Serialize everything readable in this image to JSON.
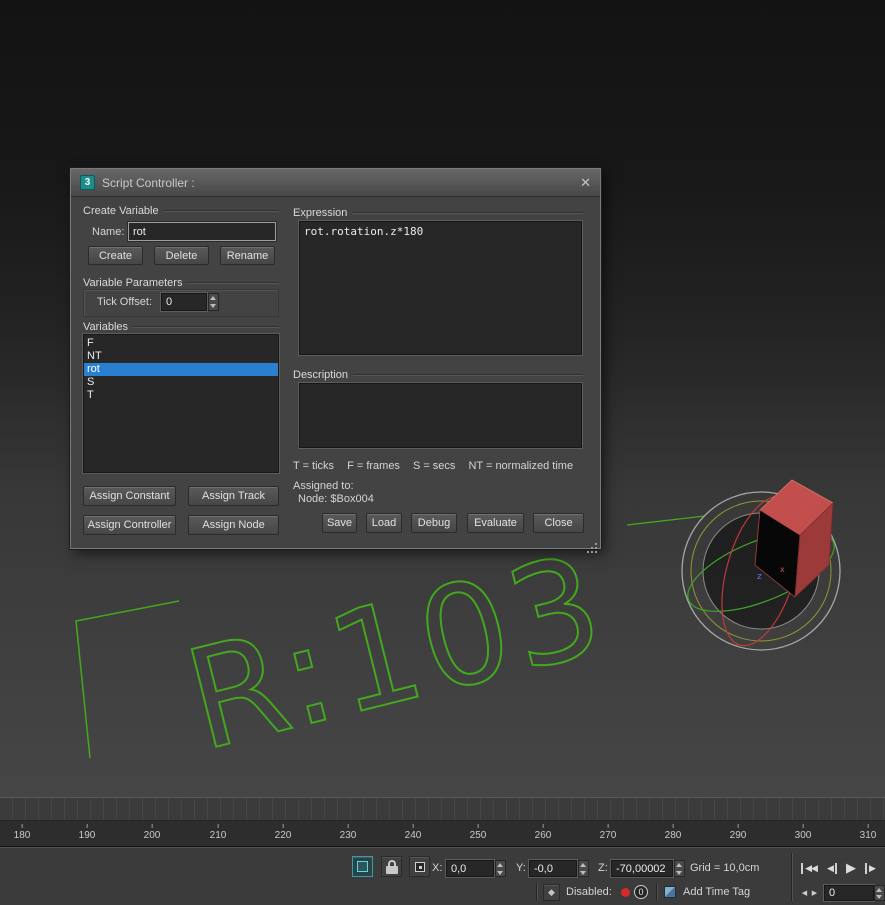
{
  "icons": {
    "logo": "3",
    "close": "✕",
    "key_mode": "◆",
    "transport_start": "◀◀",
    "transport_prev": "◀",
    "transport_play": "▶",
    "transport_next": "▶",
    "arrow_left": "◀",
    "arrow_right": "▶"
  },
  "dialog": {
    "title": "Script Controller :",
    "create_variable": {
      "label": "Create Variable",
      "name_label": "Name:",
      "name_value": "rot",
      "create": "Create",
      "delete": "Delete",
      "rename": "Rename"
    },
    "variable_parameters": {
      "label": "Variable Parameters",
      "tick_offset_label": "Tick Offset:",
      "tick_offset_value": "0"
    },
    "variables": {
      "label": "Variables",
      "items": [
        "F",
        "NT",
        "rot",
        "S",
        "T"
      ],
      "selected": "rot"
    },
    "assign": {
      "constant": "Assign Constant",
      "track": "Assign Track",
      "controller": "Assign Controller",
      "node": "Assign Node"
    },
    "expression": {
      "label": "Expression",
      "value": "rot.rotation.z*180"
    },
    "description": {
      "label": "Description",
      "value": ""
    },
    "legend": {
      "t": "T = ticks",
      "f": "F = frames",
      "s": "S = secs",
      "nt": "NT = normalized time"
    },
    "assigned_to_label": "Assigned to:",
    "assigned_node": "Node: $Box004",
    "actions": {
      "save": "Save",
      "load": "Load",
      "debug": "Debug",
      "evaluate": "Evaluate",
      "close": "Close"
    }
  },
  "viewport": {
    "rotation_readout": "R:103",
    "axis_z": "z",
    "axis_x": "x",
    "wire_color": "#43a81e"
  },
  "timeline": {
    "ticks": [
      "180",
      "190",
      "200",
      "210",
      "220",
      "230",
      "240",
      "250",
      "260",
      "270",
      "280",
      "290",
      "300",
      "310"
    ]
  },
  "status": {
    "x_label": "X:",
    "x_value": "0,0",
    "y_label": "Y:",
    "y_value": "-0,0",
    "z_label": "Z:",
    "z_value": "-70,00002",
    "grid_label": "Grid = 10,0cm",
    "disabled_label": "Disabled:",
    "key_count": "0",
    "add_time_tag": "Add Time Tag",
    "frame_spinner_value": "0"
  }
}
